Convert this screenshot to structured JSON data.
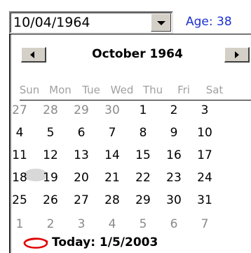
{
  "date_field": {
    "value": "10/04/1964"
  },
  "age_label": "Age: 38",
  "calendar": {
    "month_title": "October 1964",
    "weekdays": [
      "Sun",
      "Mon",
      "Tue",
      "Wed",
      "Thu",
      "Fri",
      "Sat"
    ],
    "weeks": [
      [
        {
          "d": "27",
          "o": true
        },
        {
          "d": "28",
          "o": true
        },
        {
          "d": "29",
          "o": true
        },
        {
          "d": "30",
          "o": true
        },
        {
          "d": "1"
        },
        {
          "d": "2"
        },
        {
          "d": "3"
        }
      ],
      [
        {
          "d": "4",
          "sel": true
        },
        {
          "d": "5"
        },
        {
          "d": "6"
        },
        {
          "d": "7"
        },
        {
          "d": "8"
        },
        {
          "d": "9"
        },
        {
          "d": "10"
        }
      ],
      [
        {
          "d": "11"
        },
        {
          "d": "12"
        },
        {
          "d": "13"
        },
        {
          "d": "14"
        },
        {
          "d": "15"
        },
        {
          "d": "16"
        },
        {
          "d": "17"
        }
      ],
      [
        {
          "d": "18"
        },
        {
          "d": "19"
        },
        {
          "d": "20"
        },
        {
          "d": "21"
        },
        {
          "d": "22"
        },
        {
          "d": "23"
        },
        {
          "d": "24"
        }
      ],
      [
        {
          "d": "25"
        },
        {
          "d": "26"
        },
        {
          "d": "27"
        },
        {
          "d": "28"
        },
        {
          "d": "29"
        },
        {
          "d": "30"
        },
        {
          "d": "31"
        }
      ],
      [
        {
          "d": "1",
          "o": true
        },
        {
          "d": "2",
          "o": true
        },
        {
          "d": "3",
          "o": true
        },
        {
          "d": "4",
          "o": true
        },
        {
          "d": "5",
          "o": true
        },
        {
          "d": "6",
          "o": true
        },
        {
          "d": "7",
          "o": true
        }
      ]
    ],
    "today_label": "Today: 1/5/2003",
    "selected_day": "4"
  },
  "colors": {
    "age": "#1a2fd0",
    "today_circle": "#e00000",
    "other_month": "#8a8a8a",
    "weekday_header": "#a0a0a0"
  },
  "icons": {
    "dropdown": "chevron-down-icon",
    "prev": "triangle-left-icon",
    "next": "triangle-right-icon",
    "today": "today-circle-icon"
  }
}
